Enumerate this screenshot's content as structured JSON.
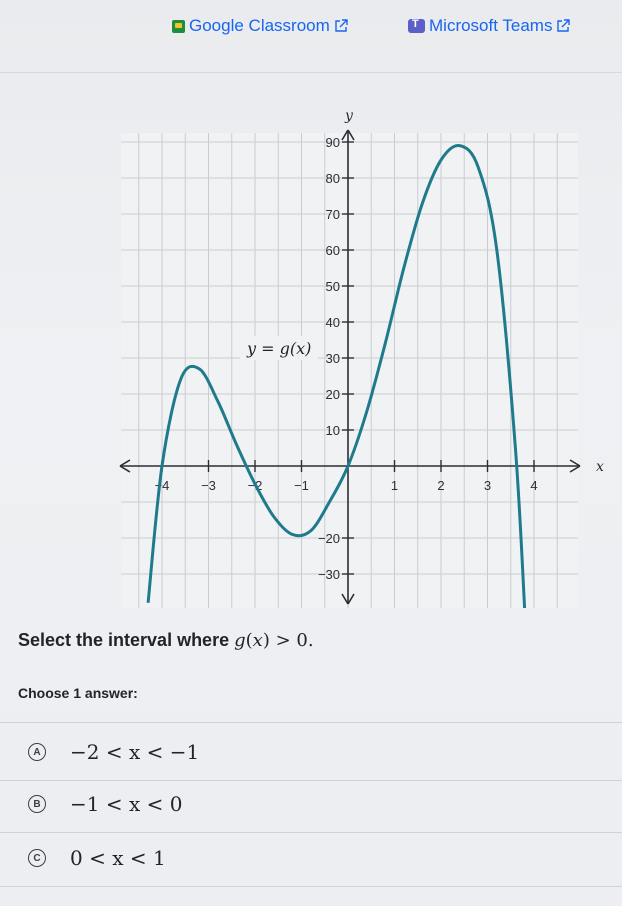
{
  "share": {
    "google_classroom": "Google Classroom",
    "microsoft_teams": "Microsoft Teams"
  },
  "graph": {
    "curve_label": "y = g(x)",
    "x_axis_label": "x",
    "y_axis_label": "y",
    "x_ticks": [
      "-4",
      "-3",
      "-2",
      "-1",
      "1",
      "2",
      "3",
      "4"
    ],
    "y_ticks": [
      "90",
      "80",
      "70",
      "60",
      "50",
      "40",
      "30",
      "20",
      "10",
      "-20",
      "-30"
    ]
  },
  "chart_data": {
    "type": "line",
    "x_axis_label": "x",
    "y_axis_label": "y",
    "curve_label": "y = g(x)",
    "xlim": [
      -4.5,
      5
    ],
    "ylim": [
      -35,
      95
    ],
    "grid": true,
    "series": [
      {
        "name": "y = g(x)",
        "x": [
          -4.3,
          -4.0,
          -3.6,
          -3.2,
          -2.8,
          -2.4,
          -2.0,
          -1.6,
          -1.2,
          -0.8,
          -0.4,
          0,
          0.4,
          0.8,
          1.2,
          1.6,
          2.0,
          2.4,
          2.8,
          3.2,
          3.6,
          3.8
        ],
        "y": [
          -38,
          0,
          24,
          27,
          18,
          6,
          -5,
          -14,
          -19,
          -18,
          -10,
          0,
          15,
          34,
          55,
          73,
          85,
          89,
          83,
          60,
          5,
          -40
        ]
      }
    ]
  },
  "question": {
    "prefix": "Select the interval where ",
    "fn": "g",
    "arg": "x",
    "suffix": " > 0."
  },
  "choose_label": "Choose 1 answer:",
  "choices": [
    {
      "letter": "A",
      "text": "−2 < x < −1"
    },
    {
      "letter": "B",
      "text": "−1 < x < 0"
    },
    {
      "letter": "C",
      "text": "0 < x < 1"
    }
  ]
}
